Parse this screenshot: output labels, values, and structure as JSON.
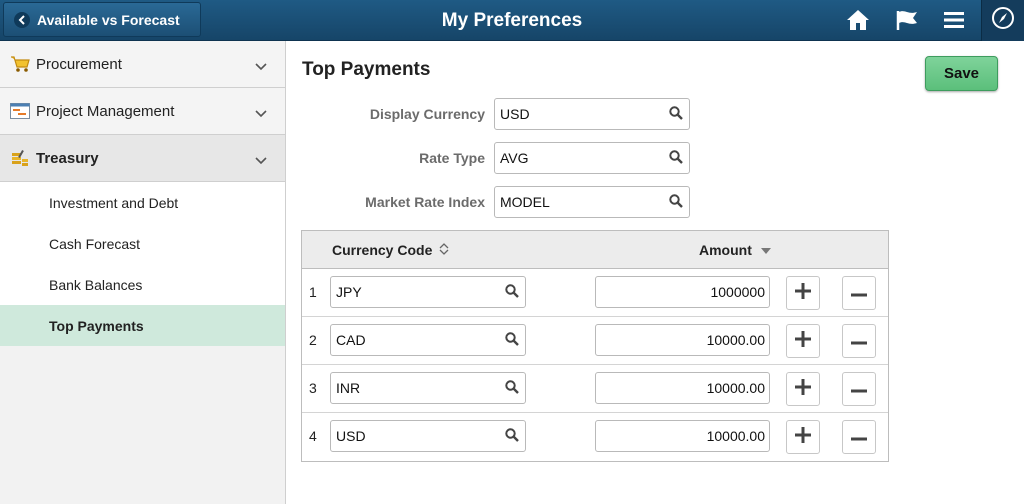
{
  "header": {
    "back_label": "Available vs Forecast",
    "title": "My Preferences",
    "icons": [
      "home-icon",
      "flag-icon",
      "menu-icon",
      "navbar-compass-icon"
    ]
  },
  "sidebar": {
    "sections": [
      {
        "label": "Procurement",
        "icon": "cart-icon"
      },
      {
        "label": "Project Management",
        "icon": "gantt-icon"
      },
      {
        "label": "Treasury",
        "icon": "coins-icon"
      }
    ],
    "items": [
      {
        "label": "Investment and Debt"
      },
      {
        "label": "Cash Forecast"
      },
      {
        "label": "Bank Balances"
      },
      {
        "label": "Top Payments"
      }
    ]
  },
  "main": {
    "title": "Top Payments",
    "save_label": "Save",
    "fields": [
      {
        "label": "Display Currency",
        "value": "USD"
      },
      {
        "label": "Rate Type",
        "value": "AVG"
      },
      {
        "label": "Market Rate Index",
        "value": "MODEL"
      }
    ],
    "grid": {
      "headers": {
        "currency_code": "Currency Code",
        "amount": "Amount"
      },
      "rows": [
        {
          "num": "1",
          "code": "JPY",
          "amount": "1000000"
        },
        {
          "num": "2",
          "code": "CAD",
          "amount": "10000.00"
        },
        {
          "num": "3",
          "code": "INR",
          "amount": "10000.00"
        },
        {
          "num": "4",
          "code": "USD",
          "amount": "10000.00"
        }
      ]
    }
  },
  "colors": {
    "header": "#1b4f78",
    "active_item": "#cfe9dc",
    "save_button": "#6cc98a"
  }
}
